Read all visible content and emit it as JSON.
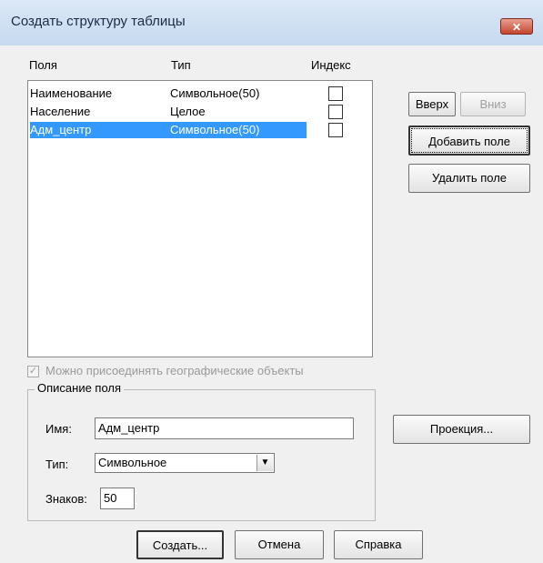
{
  "dialog": {
    "title": "Создать структуру таблицы",
    "close_symbol": "✕"
  },
  "columns": {
    "field": "Поля",
    "type": "Тип",
    "index": "Индекс"
  },
  "fields": [
    {
      "name": "Наименование",
      "type": "Символьное(50)",
      "indexed": false,
      "selected": false
    },
    {
      "name": "Население",
      "type": "Целое",
      "indexed": false,
      "selected": false
    },
    {
      "name": "Адм_центр",
      "type": "Символьное(50)",
      "indexed": false,
      "selected": true
    }
  ],
  "buttons": {
    "up": "Вверх",
    "down": "Вниз",
    "add_field": "Добавить поле",
    "delete_field": "Удалить поле",
    "projection": "Проекция...",
    "create": "Создать...",
    "cancel": "Отмена",
    "help": "Справка"
  },
  "geo": {
    "label": "Можно присоединять географические объекты",
    "checked": true,
    "check_mark": "✓"
  },
  "field_description": {
    "legend": "Описание поля",
    "name_label": "Имя:",
    "name_value": "Адм_центр",
    "type_label": "Тип:",
    "type_value": "Символьное",
    "chars_label": "Знаков:",
    "chars_value": "50"
  },
  "icons": {
    "dropdown_arrow": "▼"
  }
}
